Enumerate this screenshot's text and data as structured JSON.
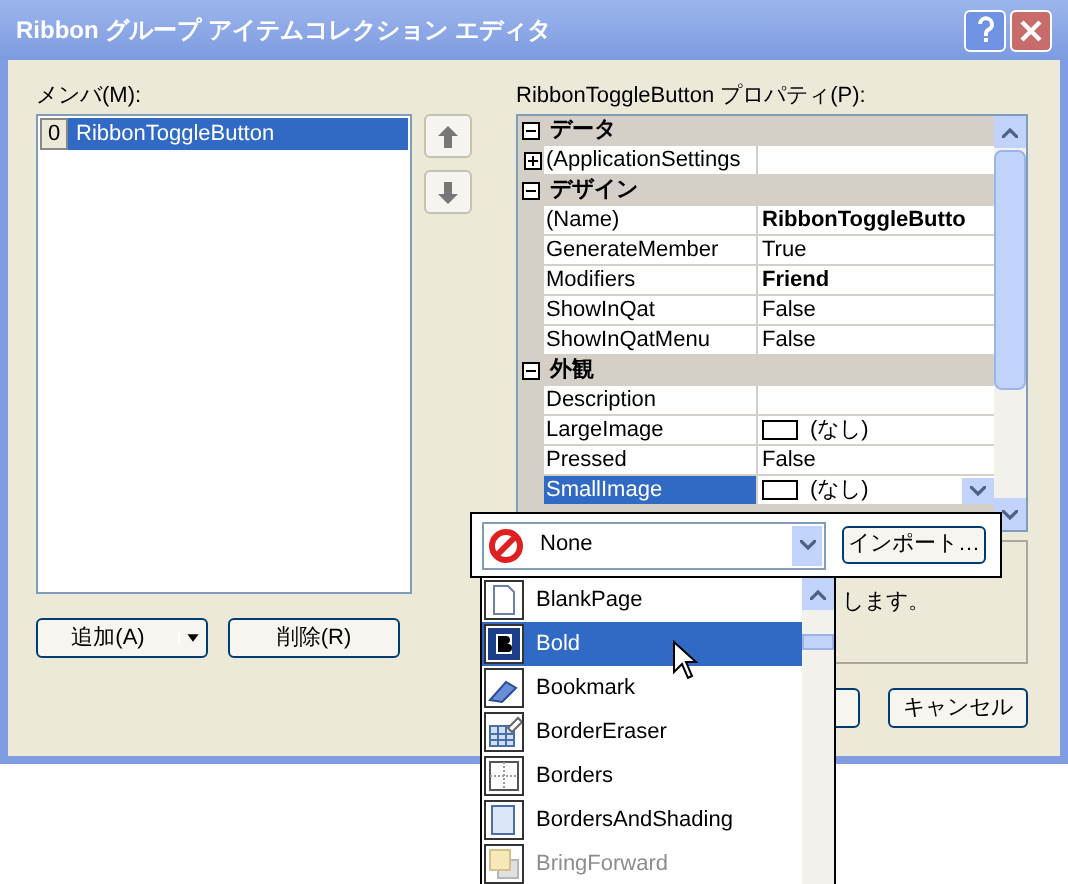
{
  "window": {
    "title": "Ribbon グループ アイテムコレクション エディタ"
  },
  "members": {
    "label": "メンバ(M):",
    "items": [
      {
        "index": "0",
        "name": "RibbonToggleButton",
        "selected": true
      }
    ]
  },
  "properties": {
    "label": "RibbonToggleButton プロパティ(P):",
    "categories": [
      {
        "name": "データ",
        "expanded": true,
        "rows": [
          {
            "name": "(ApplicationSettings",
            "value": "",
            "expandable": true,
            "kind": "text",
            "selected": false
          }
        ]
      },
      {
        "name": "デザイン",
        "expanded": true,
        "rows": [
          {
            "name": "(Name)",
            "value": "RibbonToggleButto",
            "bold": true,
            "kind": "text",
            "selected": false
          },
          {
            "name": "GenerateMember",
            "value": "True",
            "bold": false,
            "kind": "text",
            "selected": false
          },
          {
            "name": "Modifiers",
            "value": "Friend",
            "bold": true,
            "kind": "text",
            "selected": false
          },
          {
            "name": "ShowInQat",
            "value": "False",
            "bold": false,
            "kind": "text",
            "selected": false
          },
          {
            "name": "ShowInQatMenu",
            "value": "False",
            "bold": false,
            "kind": "text",
            "selected": false
          }
        ]
      },
      {
        "name": "外観",
        "expanded": true,
        "rows": [
          {
            "name": "Description",
            "value": "",
            "kind": "text",
            "selected": false
          },
          {
            "name": "LargeImage",
            "value": "(なし)",
            "bold": false,
            "kind": "image",
            "selected": false
          },
          {
            "name": "Pressed",
            "value": "False",
            "bold": false,
            "kind": "text",
            "selected": false
          },
          {
            "name": "SmallImage",
            "value": "(なし)",
            "bold": false,
            "kind": "image",
            "selected": true
          }
        ]
      }
    ]
  },
  "description": "します。",
  "buttons": {
    "add": "追加(A)",
    "remove": "削除(R)",
    "cancel": "キャンセル"
  },
  "image_picker": {
    "value": "None",
    "import": "インポート…",
    "items": [
      {
        "name": "BlankPage",
        "kind": "page",
        "selected": false,
        "disabled": false
      },
      {
        "name": "Bold",
        "kind": "bold",
        "selected": true,
        "disabled": false
      },
      {
        "name": "Bookmark",
        "kind": "bookmark",
        "selected": false,
        "disabled": false
      },
      {
        "name": "BorderEraser",
        "kind": "eraser",
        "selected": false,
        "disabled": false
      },
      {
        "name": "Borders",
        "kind": "borders",
        "selected": false,
        "disabled": false
      },
      {
        "name": "BordersAndShading",
        "kind": "shading",
        "selected": false,
        "disabled": false
      },
      {
        "name": "BringForward",
        "kind": "layers",
        "selected": false,
        "disabled": true
      }
    ]
  }
}
